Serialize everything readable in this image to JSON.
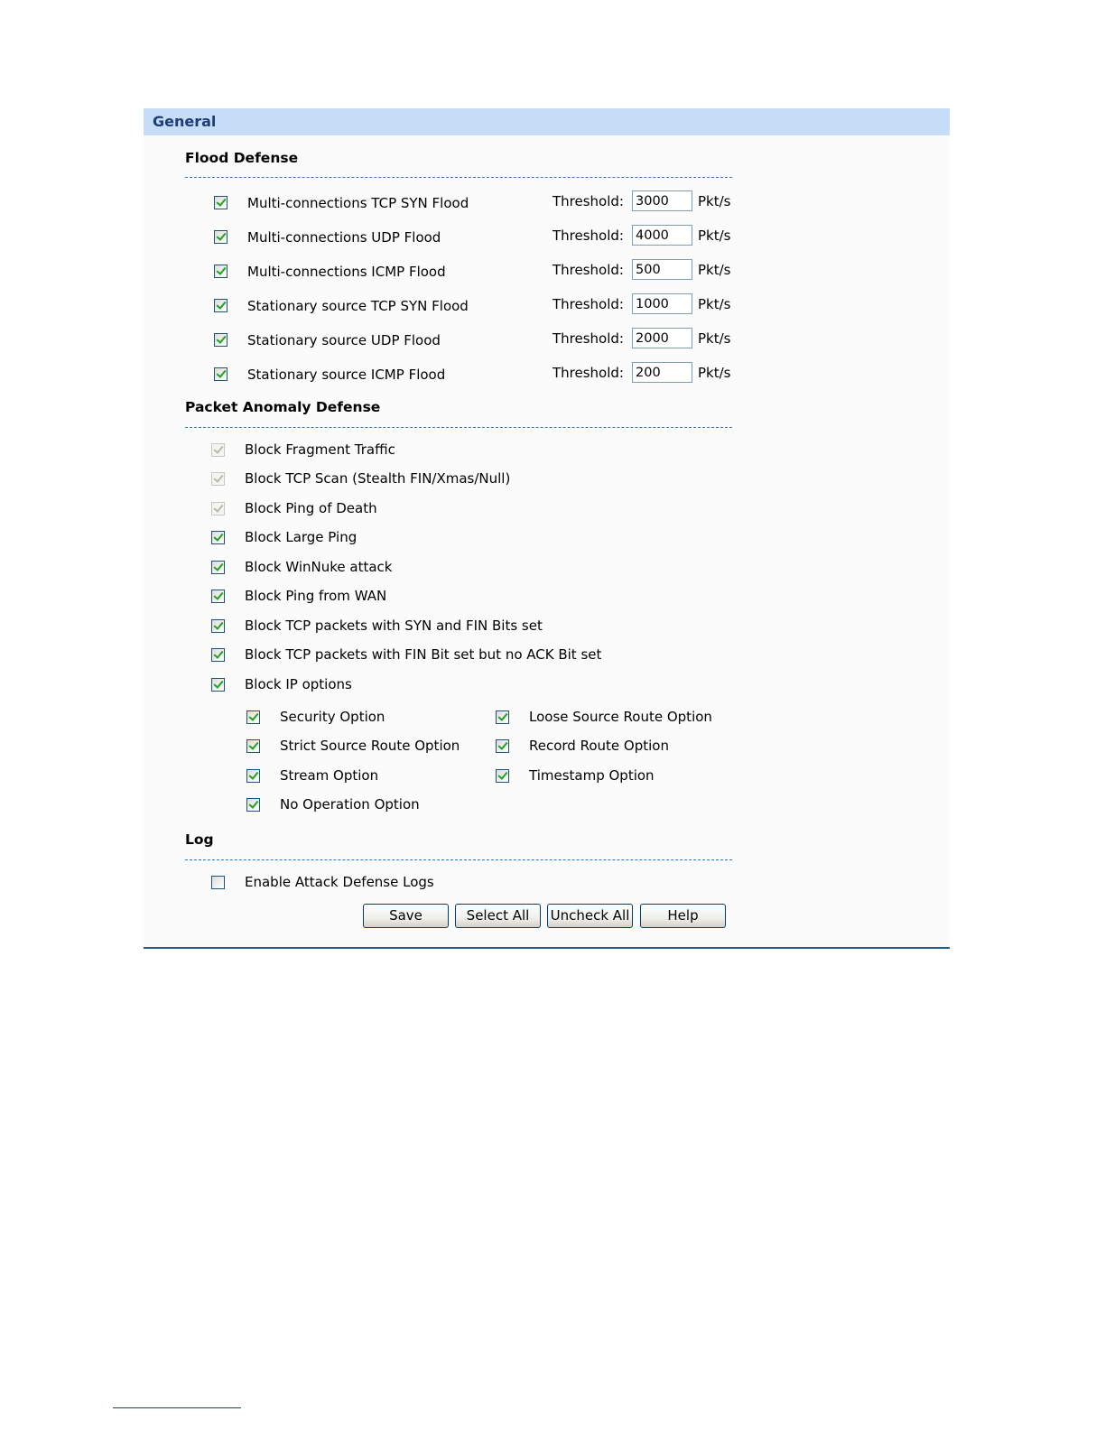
{
  "header": {
    "title": "General"
  },
  "flood": {
    "title": "Flood Defense",
    "threshold_label": "Threshold:",
    "unit": "Pkt/s",
    "rows": [
      {
        "label": "Multi-connections TCP SYN Flood",
        "checked": true,
        "value": "3000"
      },
      {
        "label": "Multi-connections UDP Flood",
        "checked": true,
        "value": "4000"
      },
      {
        "label": "Multi-connections ICMP Flood",
        "checked": true,
        "value": "500"
      },
      {
        "label": "Stationary source TCP SYN Flood",
        "checked": true,
        "value": "1000"
      },
      {
        "label": "Stationary source UDP Flood",
        "checked": true,
        "value": "2000"
      },
      {
        "label": "Stationary source ICMP Flood",
        "checked": true,
        "value": "200"
      }
    ]
  },
  "anomaly": {
    "title": "Packet Anomaly Defense",
    "items": [
      {
        "label": "Block Fragment Traffic",
        "checked": true,
        "disabled": true
      },
      {
        "label": "Block TCP Scan (Stealth FIN/Xmas/Null)",
        "checked": true,
        "disabled": true
      },
      {
        "label": "Block Ping of Death",
        "checked": true,
        "disabled": true
      },
      {
        "label": "Block Large Ping",
        "checked": true,
        "disabled": false
      },
      {
        "label": "Block WinNuke attack",
        "checked": true,
        "disabled": false
      },
      {
        "label": "Block Ping from WAN",
        "checked": true,
        "disabled": false
      },
      {
        "label": "Block TCP packets with SYN and FIN Bits set",
        "checked": true,
        "disabled": false
      },
      {
        "label": "Block TCP packets with FIN Bit set but no ACK Bit set",
        "checked": true,
        "disabled": false
      },
      {
        "label": "Block IP options",
        "checked": true,
        "disabled": false
      }
    ],
    "ip_options": [
      {
        "label": "Security Option",
        "checked": true
      },
      {
        "label": "Loose Source Route Option",
        "checked": true
      },
      {
        "label": "Strict Source Route Option",
        "checked": true
      },
      {
        "label": "Record Route Option",
        "checked": true
      },
      {
        "label": "Stream Option",
        "checked": true
      },
      {
        "label": "Timestamp Option",
        "checked": true
      },
      {
        "label": "No Operation Option",
        "checked": true
      }
    ]
  },
  "log": {
    "title": "Log",
    "enable_label": "Enable Attack Defense Logs",
    "enable_checked": false
  },
  "buttons": {
    "save": "Save",
    "select_all": "Select All",
    "uncheck_all": "Uncheck All",
    "help": "Help"
  },
  "colors": {
    "header_bg": "#c6dcf7",
    "header_text": "#1d3d78",
    "check_green": "#21a121",
    "divider_blue": "#3a6fb0"
  }
}
